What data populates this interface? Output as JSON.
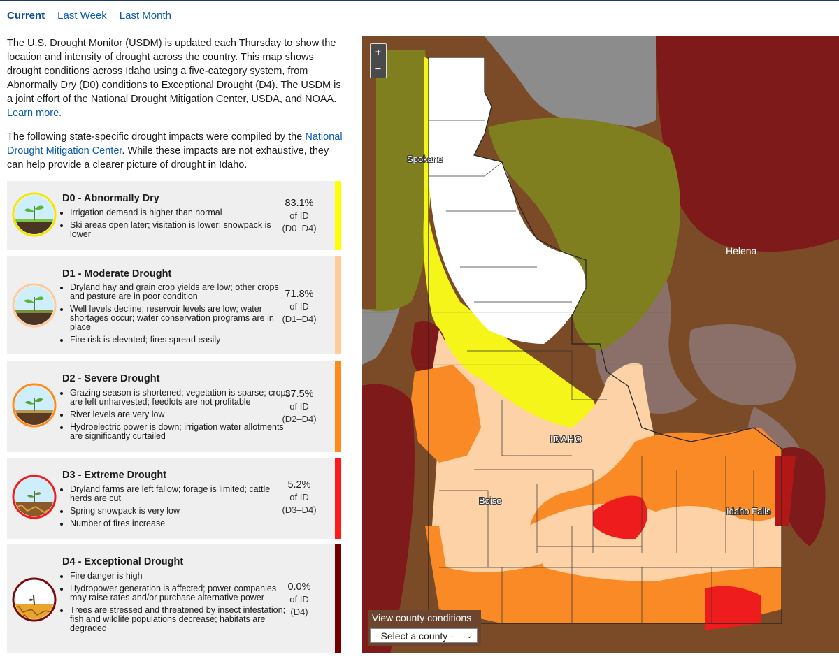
{
  "tabs": [
    {
      "label": "Current",
      "active": true
    },
    {
      "label": "Last Week",
      "active": false
    },
    {
      "label": "Last Month",
      "active": false
    }
  ],
  "intro": {
    "p1": "The U.S. Drought Monitor (USDM) is updated each Thursday to show the location and intensity of drought across the country. This map shows drought conditions across Idaho using a five-category system, from Abnormally Dry (D0) conditions to Exceptional Drought (D4). The USDM is a joint effort of the National Drought Mitigation Center, USDA, and NOAA.",
    "learn_more": "Learn more.",
    "p2_a": "The following state-specific drought impacts were compiled by the",
    "p2_link": "National Drought Mitigation Center",
    "p2_b": ". While these impacts are not exhaustive, they can help provide a clearer picture of drought in Idaho."
  },
  "categories": [
    {
      "title": "D0 - Abnormally Dry",
      "color": "#ffff00",
      "impacts": [
        "Irrigation demand is higher than normal",
        "Ski areas open later; visitation is lower; snowpack is lower"
      ],
      "pct": "83.1%",
      "of": "of ID",
      "range": "(D0–D4)"
    },
    {
      "title": "D1 - Moderate Drought",
      "color": "#ffcc99",
      "impacts": [
        "Dryland hay and grain crop yields are low; other crops and pasture are in poor condition",
        "Well levels decline; reservoir levels are low; water shortages occur; water conservation programs are in place",
        "Fire risk is elevated; fires spread easily"
      ],
      "pct": "71.8%",
      "of": "of ID",
      "range": "(D1–D4)"
    },
    {
      "title": "D2 - Severe Drought",
      "color": "#ff8c1a",
      "impacts": [
        "Grazing season is shortened; vegetation is sparse; crops are left unharvested; feedlots are not profitable",
        "River levels are very low",
        "Hydroelectric power is down; irrigation water allotments are significantly curtailed"
      ],
      "pct": "37.5%",
      "of": "of ID",
      "range": "(D2–D4)"
    },
    {
      "title": "D3 - Extreme Drought",
      "color": "#ff1a1a",
      "impacts": [
        "Dryland farms are left fallow; forage is limited; cattle herds are cut",
        "Spring snowpack is very low",
        "Number of fires increase"
      ],
      "pct": "5.2%",
      "of": "of ID",
      "range": "(D3–D4)"
    },
    {
      "title": "D4 - Exceptional Drought",
      "color": "#730000",
      "impacts": [
        "Fire danger is high",
        "Hydropower generation is affected; power companies may raise rates and/or purchase alternative power",
        "Trees are stressed and threatened by insect infestation; fish and wildlife populations decrease; habitats are degraded"
      ],
      "pct": "0.0%",
      "of": "of ID",
      "range": "(D4)"
    }
  ],
  "map": {
    "zoom_in": "+",
    "zoom_out": "−",
    "cities": {
      "spokane": "Spokane",
      "helena": "Helena",
      "idaho": "IDAHO",
      "boise": "Boise",
      "idaho_falls": "Idaho Falls"
    },
    "county_label": "View county conditions",
    "county_select": "- Select a county -",
    "chevron": "⌄"
  }
}
